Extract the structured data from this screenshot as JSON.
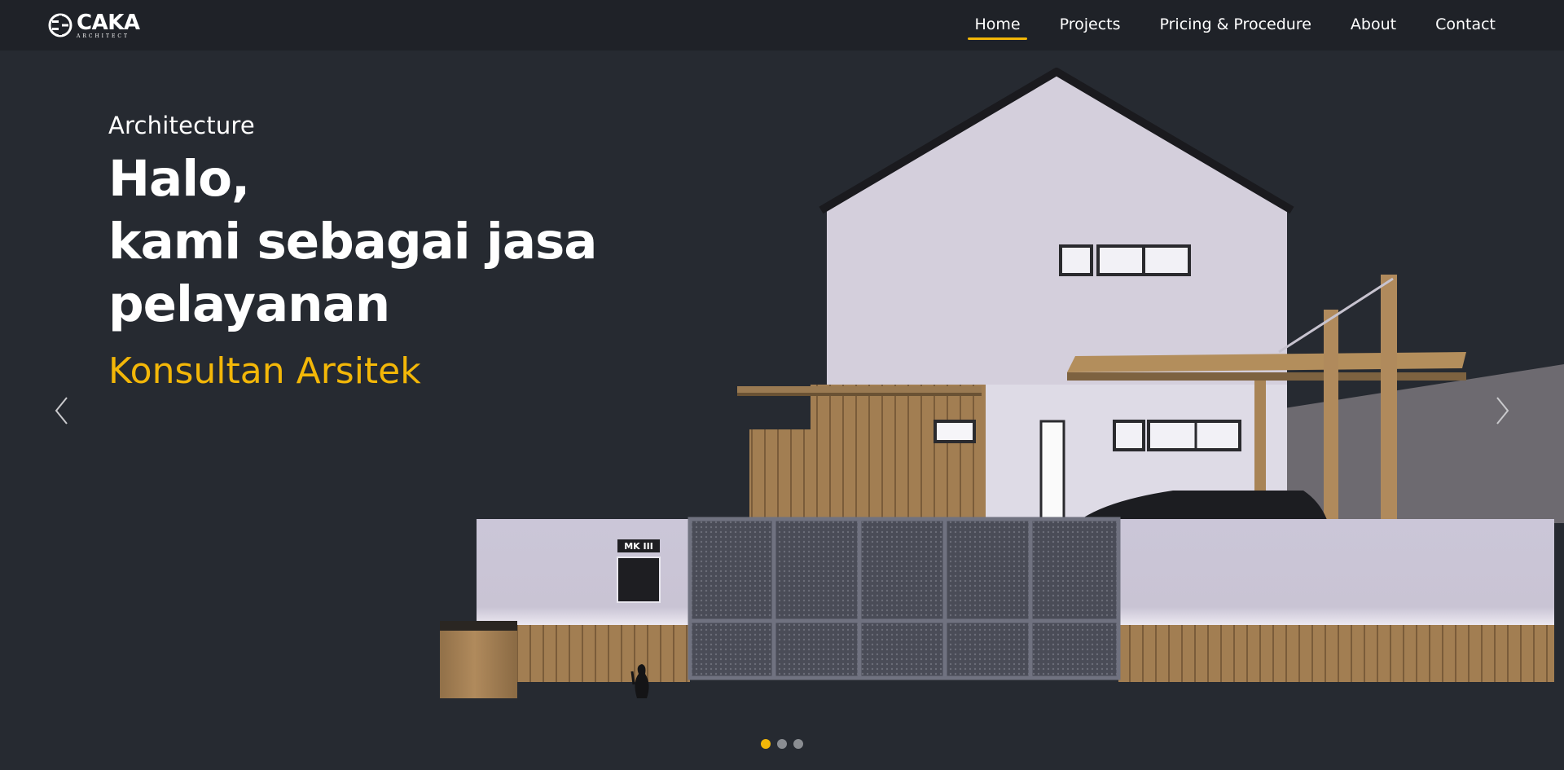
{
  "brand": {
    "name": "CAKA",
    "subtitle": "ARCHITECT"
  },
  "nav": {
    "items": [
      {
        "label": "Home",
        "active": true
      },
      {
        "label": "Projects",
        "active": false
      },
      {
        "label": "Pricing & Procedure",
        "active": false
      },
      {
        "label": "About",
        "active": false
      },
      {
        "label": "Contact",
        "active": false
      }
    ]
  },
  "hero": {
    "eyebrow": "Architecture",
    "headline_lines": [
      "Halo,",
      "kami sebagai jasa",
      "pelayanan"
    ],
    "highlight": "Konsultan Arsitek",
    "sign_text": "MK III"
  },
  "carousel": {
    "slide_count": 3,
    "active_index": 0
  },
  "colors": {
    "accent": "#f3b708",
    "background": "#262a31",
    "navbar": "#1f2228"
  },
  "icons": {
    "prev": "chevron-left-icon",
    "next": "chevron-right-icon"
  }
}
